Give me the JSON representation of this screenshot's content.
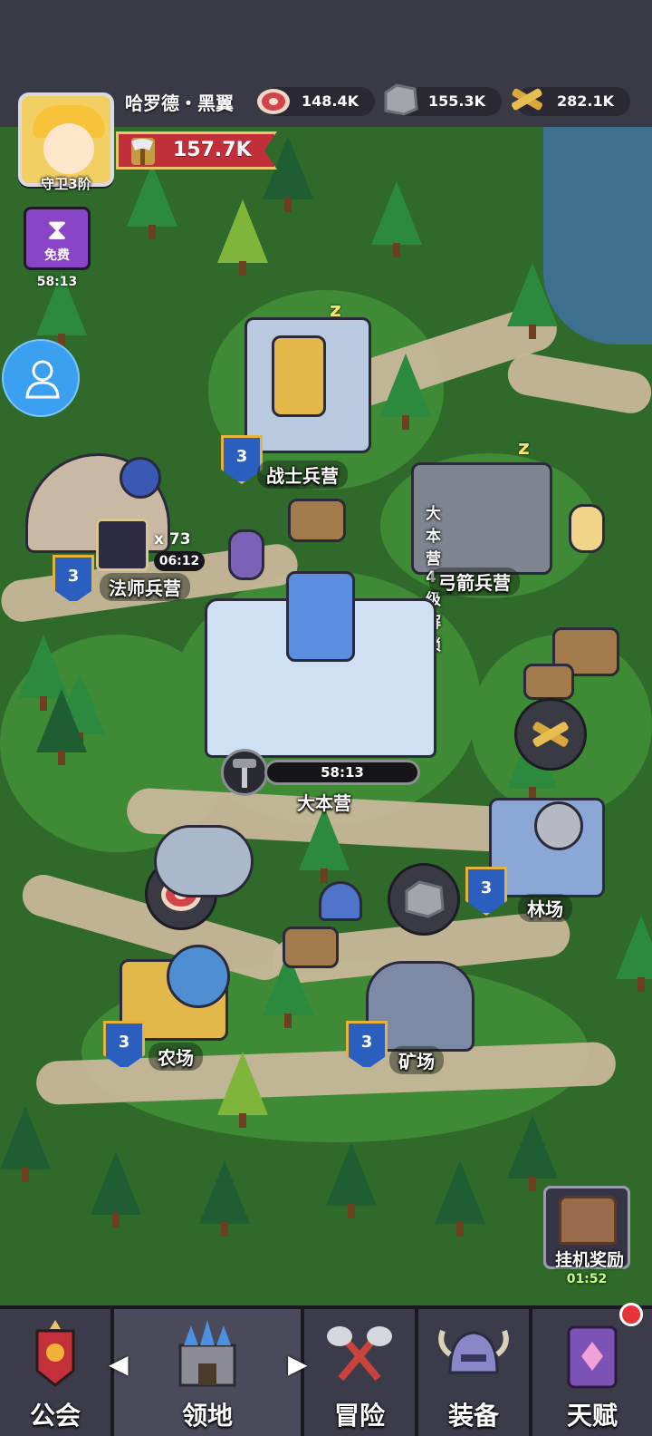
{
  "player": {
    "name": "哈罗德・黑翼",
    "rank": "守卫3阶",
    "power": "157.7K"
  },
  "resources": [
    {
      "name": "meat",
      "icon": "meat-icon",
      "value": "148.4K"
    },
    {
      "name": "stone",
      "icon": "stone-icon",
      "value": "155.3K"
    },
    {
      "name": "wood",
      "icon": "wood-icon",
      "value": "282.1K"
    }
  ],
  "free_button": {
    "label": "免费",
    "timer": "58:13"
  },
  "buildings": {
    "warrior_barracks": {
      "label": "战士兵营",
      "level": "3"
    },
    "mage_barracks": {
      "label": "法师兵营",
      "level": "3",
      "troop_count": "x 73",
      "timer": "06:12"
    },
    "archer_barracks": {
      "label": "弓箭兵营",
      "lock_text": "大本营4级解锁"
    },
    "main_base": {
      "label": "大本营",
      "timer": "58:13"
    },
    "lumber_yard": {
      "label": "林场",
      "level": "3"
    },
    "farm": {
      "label": "农场",
      "level": "3"
    },
    "mine": {
      "label": "矿场",
      "level": "3"
    }
  },
  "idle_reward": {
    "label": "挂机奖励",
    "timer": "01:52"
  },
  "nav": [
    {
      "label": "公会",
      "icon": "guild-banner-icon"
    },
    {
      "label": "领地",
      "icon": "castle-icon"
    },
    {
      "label": "冒险",
      "icon": "crossed-axes-icon"
    },
    {
      "label": "装备",
      "icon": "helmet-icon"
    },
    {
      "label": "天赋",
      "icon": "talent-book-icon"
    }
  ],
  "colors": {
    "accent_red": "#c1303a",
    "level_badge": "#2a5fc0",
    "gold": "#e5b33b",
    "grass": "#3f8a35"
  }
}
